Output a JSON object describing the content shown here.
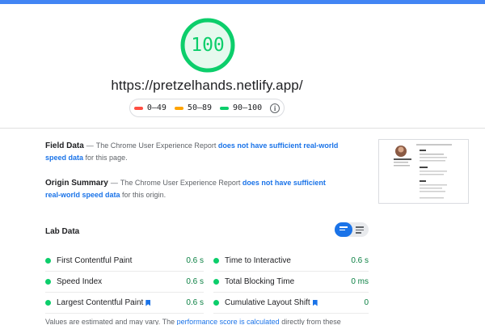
{
  "score": {
    "value": "100",
    "fraction": 1.0
  },
  "url": "https://pretzelhands.netlify.app/",
  "legend": [
    {
      "label": "0–49",
      "color": "#ff4e42"
    },
    {
      "label": "50–89",
      "color": "#ffa400"
    },
    {
      "label": "90–100",
      "color": "#0cce6b"
    }
  ],
  "field_data": {
    "title": "Field Data",
    "dash": "—",
    "text_before": "The Chrome User Experience Report",
    "link": "does not have sufficient real-world speed data",
    "text_after": "for this page."
  },
  "origin_summary": {
    "title": "Origin Summary",
    "dash": "—",
    "text_before": "The Chrome User Experience Report",
    "link": "does not have sufficient real-world speed data",
    "text_after": "for this origin."
  },
  "lab_data": {
    "title": "Lab Data",
    "metrics": [
      {
        "label": "First Contentful Paint",
        "value": "0.6 s",
        "bookmark": false
      },
      {
        "label": "Time to Interactive",
        "value": "0.6 s",
        "bookmark": false
      },
      {
        "label": "Speed Index",
        "value": "0.6 s",
        "bookmark": false
      },
      {
        "label": "Total Blocking Time",
        "value": "0 ms",
        "bookmark": false
      },
      {
        "label": "Largest Contentful Paint",
        "value": "0.6 s",
        "bookmark": true
      },
      {
        "label": "Cumulative Layout Shift",
        "value": "0",
        "bookmark": true
      }
    ]
  },
  "footer": {
    "text_before": "Values are estimated and may vary. The",
    "link": "performance score is calculated",
    "text_after": "directly from these"
  },
  "colors": {
    "accent": "#1a73e8",
    "pass": "#0cce6b",
    "pass_text": "#0b8043",
    "top_bar": "#4285f4"
  }
}
